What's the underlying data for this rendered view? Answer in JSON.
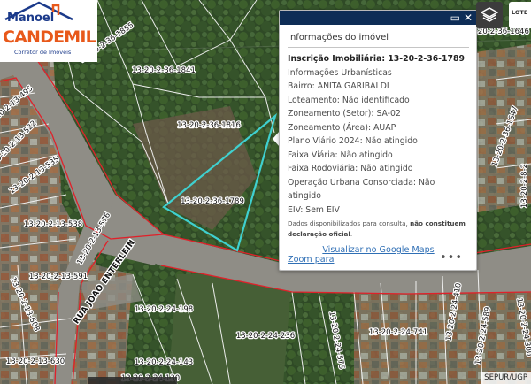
{
  "logo": {
    "top": "Manoel",
    "main": "CANDEMIL",
    "sub": "Corretor de Imóveis"
  },
  "streets": {
    "rua_joao_enterlein": "RUA JOAO ENTERLEIN"
  },
  "lot_labels": [
    "13-20-2-36-1855",
    "13-20-2-36-1841",
    "13-20-2-36-1816",
    "13-20-2-36-1789",
    "13-20-2-36-1646",
    "13-20-2-36-1647",
    "13-20-2-13-495",
    "13-20-2-13-522",
    "13-20-2-13-535",
    "13-20-2-13-538",
    "13-20-2-13-576",
    "13-20-2-13-591",
    "13-20-2-13-608",
    "13-20-2-13-630",
    "13-20-2-24-198",
    "13-20-2-24-236",
    "13-20-2-24-143",
    "13-20-2-24-130",
    "13-20-2-24-741",
    "13-20-2-24-410",
    "13-20-2-24-575",
    "13-20-2-24-589",
    "13-20-2-24-300",
    "13-20-2-8-2"
  ],
  "popup": {
    "title": "Informações do imóvel",
    "inscricao": "Inscrição Imobiliária: 13-20-2-36-1789",
    "informacoes": "Informações Urbanísticas",
    "bairro": "Bairro: ANITA GARIBALDI",
    "loteamento": "Loteamento: Não identificado",
    "zoneamento_setor": "Zoneamento (Setor): SA-02",
    "zoneamento_area": "Zoneamento (Área): AUAP",
    "plano_viario": "Plano Viário 2024: Não atingido",
    "faixa_viaria": "Faixa Viária: Não atingido",
    "faixa_rodoviaria": "Faixa Rodoviária: Não atingido",
    "operacao": "Operação Urbana Consorciada: Não atingido",
    "eiv": "EIV: Sem EIV",
    "disclaimer_start": "Dados disponibilizados para consulta, ",
    "disclaimer_bold": "não constituem declaração oficial",
    "disclaimer_end": ".",
    "google_maps_link": "Visualizar no Google Maps",
    "zoom_link": "Zoom para",
    "more": "•••"
  },
  "buttons": {
    "lotes": "LOTE"
  },
  "attribution": "SEPUR/UGP",
  "colors": {
    "header": "#0e2d56",
    "link": "#2f6fb5",
    "highlight": "#3fd0cf",
    "road_border": "#e0212a",
    "logo_orange": "#e8581a",
    "logo_blue": "#1b3a8a"
  },
  "icons": {
    "maximize": "maximize-icon",
    "close": "close-icon",
    "layers": "layers-icon",
    "more": "more-options-icon",
    "logo_house": "house-roof-icon"
  }
}
